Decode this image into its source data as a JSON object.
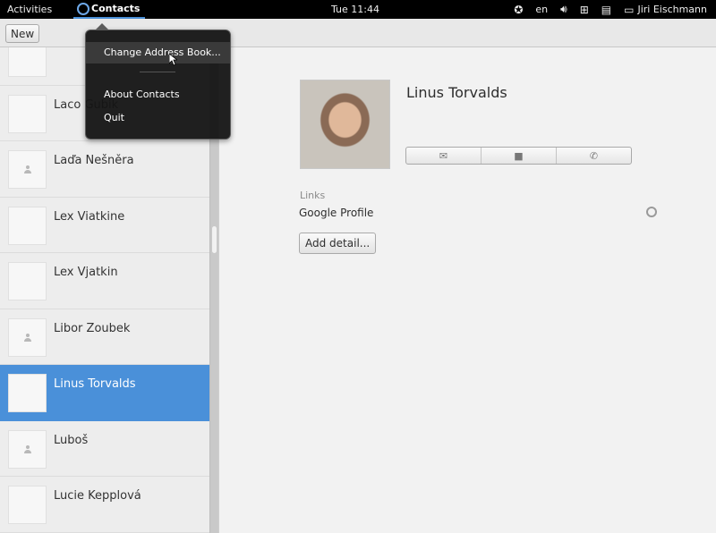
{
  "topbar": {
    "activities": "Activities",
    "app_name": "Contacts",
    "clock": "Tue 11:44",
    "language": "en",
    "user": "Jiri Eischmann"
  },
  "toolbar": {
    "new_label": "New"
  },
  "app_menu": {
    "items": [
      "Change Address Book...",
      "About Contacts",
      "Quit"
    ]
  },
  "contacts": [
    {
      "name": "",
      "photo": "dark"
    },
    {
      "name": "Laco Gubík",
      "photo": "laco"
    },
    {
      "name": "Laďa Nešněra",
      "photo": "none"
    },
    {
      "name": "Lex Viatkine",
      "photo": "dark"
    },
    {
      "name": "Lex Vjatkin",
      "photo": "dark"
    },
    {
      "name": "Libor Zoubek",
      "photo": "none"
    },
    {
      "name": "Linus Torvalds",
      "photo": "linus",
      "selected": true
    },
    {
      "name": "Luboš",
      "photo": "none"
    },
    {
      "name": "Lucie Kepplová",
      "photo": "lucie"
    }
  ],
  "detail": {
    "name": "Linus Torvalds",
    "actions": [
      "mail-icon",
      "chat-icon",
      "phone-icon"
    ],
    "links_label": "Links",
    "link_value": "Google Profile",
    "add_detail_label": "Add detail..."
  },
  "colors": {
    "selection": "#4a90d9",
    "topbar": "#000000"
  }
}
